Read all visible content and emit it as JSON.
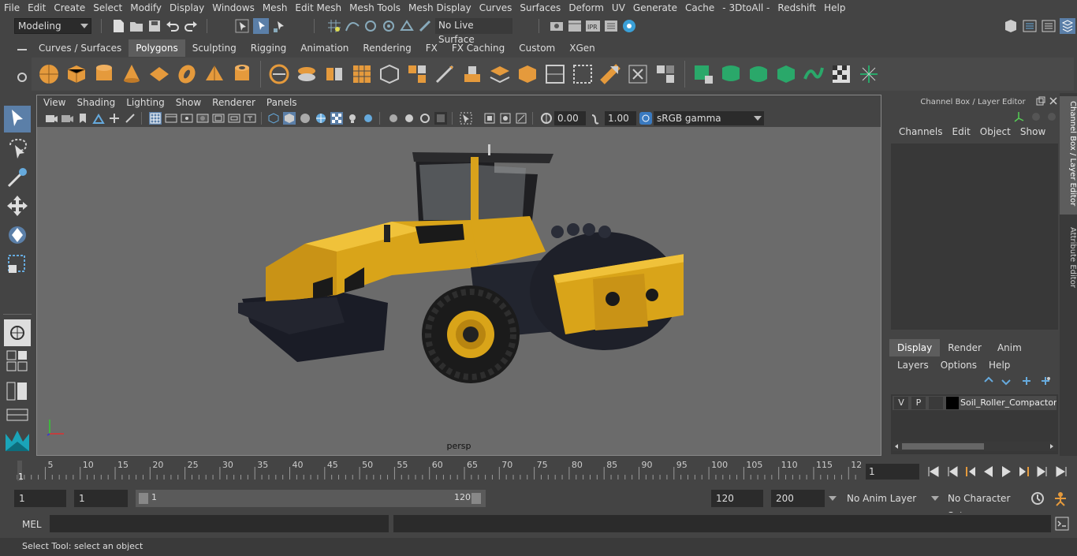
{
  "menubar": {
    "items": [
      "File",
      "Edit",
      "Create",
      "Select",
      "Modify",
      "Display",
      "Windows",
      "Mesh",
      "Edit Mesh",
      "Mesh Tools",
      "Mesh Display",
      "Curves",
      "Surfaces",
      "Deform",
      "UV",
      "Generate",
      "Cache",
      "- 3DtoAll -",
      "Redshift",
      "Help"
    ]
  },
  "statusline": {
    "mode": "Modeling",
    "live_surface": "No Live Surface"
  },
  "shelf": {
    "tabs": [
      "Curves / Surfaces",
      "Polygons",
      "Sculpting",
      "Rigging",
      "Animation",
      "Rendering",
      "FX",
      "FX Caching",
      "Custom",
      "XGen"
    ],
    "active_tab": "Polygons"
  },
  "viewport": {
    "menu": [
      "View",
      "Shading",
      "Lighting",
      "Show",
      "Renderer",
      "Panels"
    ],
    "near_value": "0.00",
    "far_value": "1.00",
    "color_space": "sRGB gamma",
    "camera": "persp"
  },
  "channelbox": {
    "title": "Channel Box / Layer Editor",
    "menu": [
      "Channels",
      "Edit",
      "Object",
      "Show"
    ],
    "layer_tabs": [
      "Display",
      "Render",
      "Anim"
    ],
    "active_layer_tab": "Display",
    "layer_menu": [
      "Layers",
      "Options",
      "Help"
    ],
    "layer": {
      "v": "V",
      "p": "P",
      "name": "Soil_Roller_Compactor"
    }
  },
  "sidetabs": {
    "channel_box": "Channel Box / Layer Editor",
    "attribute_editor": "Attribute Editor"
  },
  "timeline": {
    "ticks": [
      "5",
      "10",
      "15",
      "20",
      "25",
      "30",
      "35",
      "40",
      "45",
      "50",
      "55",
      "60",
      "65",
      "70",
      "75",
      "80",
      "85",
      "90",
      "95",
      "100",
      "105",
      "110",
      "115",
      "12"
    ],
    "current_frame_marker": "1",
    "current_frame": "1"
  },
  "range": {
    "start": "1",
    "playback_start": "1",
    "slider_start": "1",
    "slider_end": "120",
    "playback_end": "120",
    "end": "200",
    "anim_layer": "No Anim Layer",
    "character_set": "No Character Set"
  },
  "cmdline": {
    "label": "MEL"
  },
  "helpline": {
    "text": "Select Tool: select an object"
  }
}
